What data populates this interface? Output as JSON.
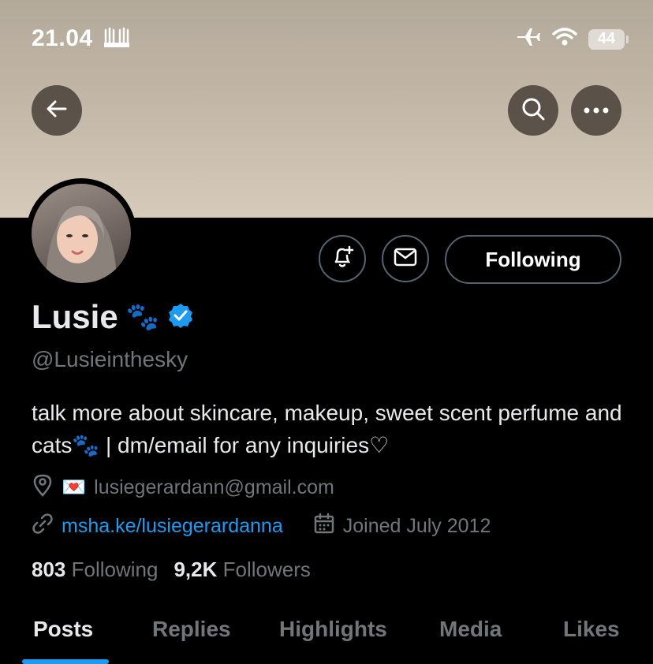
{
  "status_bar": {
    "time": "21.04",
    "battery": "44"
  },
  "profile": {
    "name": "Lusie",
    "name_emoji": "🐾",
    "handle": "@Lusieinthesky",
    "bio": "talk more about skincare, makeup, sweet scent perfume and cats🐾 | dm/email for any inquiries♡",
    "location_text": "lusiegerardann@gmail.com",
    "location_emoji": "💌",
    "website": "msha.ke/lusiegerardanna",
    "joined": "Joined July 2012",
    "following_count": "803",
    "following_label": "Following",
    "followers_count": "9,2K",
    "followers_label": "Followers"
  },
  "actions": {
    "follow_button": "Following"
  },
  "tabs": [
    {
      "label": "Posts",
      "active": true
    },
    {
      "label": "Replies",
      "active": false
    },
    {
      "label": "Highlights",
      "active": false
    },
    {
      "label": "Media",
      "active": false
    },
    {
      "label": "Likes",
      "active": false
    }
  ],
  "colors": {
    "accent": "#1d9bf0",
    "background": "#000000",
    "verified": "#1d9bf0"
  },
  "icons": [
    "back-arrow-icon",
    "search-icon",
    "more-icon",
    "airplane-icon",
    "wifi-icon",
    "bell-plus-icon",
    "mail-icon",
    "verified-icon",
    "location-icon",
    "link-icon",
    "calendar-icon"
  ]
}
